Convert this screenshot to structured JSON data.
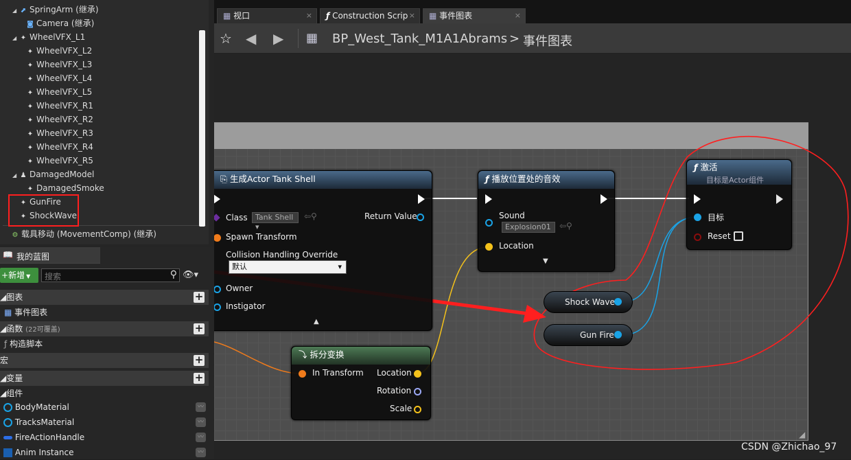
{
  "components_tree": {
    "items": [
      {
        "label": "SpringArm (继承)",
        "icon": "spring-arm-icon"
      },
      {
        "label": "Camera (继承)",
        "icon": "camera-icon"
      },
      {
        "label": "WheelVFX_L1",
        "icon": "particle-icon"
      },
      {
        "label": "WheelVFX_L2",
        "icon": "particle-icon"
      },
      {
        "label": "WheelVFX_L3",
        "icon": "particle-icon"
      },
      {
        "label": "WheelVFX_L4",
        "icon": "particle-icon"
      },
      {
        "label": "WheelVFX_L5",
        "icon": "particle-icon"
      },
      {
        "label": "WheelVFX_R1",
        "icon": "particle-icon"
      },
      {
        "label": "WheelVFX_R2",
        "icon": "particle-icon"
      },
      {
        "label": "WheelVFX_R3",
        "icon": "particle-icon"
      },
      {
        "label": "WheelVFX_R4",
        "icon": "particle-icon"
      },
      {
        "label": "WheelVFX_R5",
        "icon": "particle-icon"
      },
      {
        "label": "DamagedModel",
        "icon": "skeletal-mesh-icon"
      },
      {
        "label": "DamagedSmoke",
        "icon": "particle-icon"
      },
      {
        "label": "GunFire",
        "icon": "particle-icon"
      },
      {
        "label": "ShockWave",
        "icon": "particle-icon"
      },
      {
        "label": "载具移动 (MovementComp) (继承)",
        "icon": "movement-icon"
      }
    ]
  },
  "my_blueprint": {
    "tab_label": "我的蓝图",
    "add_new_label": "新增",
    "search_placeholder": "搜索",
    "sections": {
      "graphs": "图表",
      "event_graph": "事件图表",
      "functions": "函数",
      "functions_count": "(22可覆盖)",
      "construction_script": "构造脚本",
      "macros": "宏",
      "variables": "变量",
      "components": "组件"
    },
    "variables": [
      {
        "label": "BodyMaterial"
      },
      {
        "label": "TracksMaterial"
      },
      {
        "label": "FireActionHandle"
      },
      {
        "label": "Anim Instance"
      }
    ]
  },
  "editor_tabs": [
    {
      "label": "视口"
    },
    {
      "label": "Construction Scrip"
    },
    {
      "label": "事件图表"
    }
  ],
  "breadcrumb": {
    "blueprint": "BP_West_Tank_M1A1Abrams",
    "separator": ">",
    "graph": "事件图表"
  },
  "nodes": {
    "spawn": {
      "title": "生成Actor Tank Shell",
      "class_label": "Class",
      "class_value": "Tank Shell",
      "return_label": "Return Value",
      "spawn_transform": "Spawn Transform",
      "collision_label": "Collision Handling Override",
      "collision_value": "默认",
      "owner": "Owner",
      "instigator": "Instigator"
    },
    "play_sound": {
      "title": "播放位置处的音效",
      "sound_label": "Sound",
      "sound_value": "Explosion01",
      "location_label": "Location"
    },
    "activate": {
      "title": "激活",
      "subtitle": "目标是Actor组件",
      "target_label": "目标",
      "reset_label": "Reset"
    },
    "break_transform": {
      "title": "拆分变换",
      "in_transform": "In Transform",
      "location": "Location",
      "rotation": "Rotation",
      "scale": "Scale"
    },
    "shock_wave": {
      "label": "Shock Wave"
    },
    "gun_fire": {
      "label": "Gun Fire"
    }
  },
  "watermark": "CSDN @Zhichao_97",
  "colors": {
    "exec_pin": "#ffffff",
    "object_pin": "#1aa3e6",
    "vector_pin": "#f5c21b",
    "rotator_pin": "#9ba8f5",
    "transform_pin": "#f07b1b",
    "class_pin": "#6b2d9e",
    "annotation_red": "#ff1f1f"
  }
}
